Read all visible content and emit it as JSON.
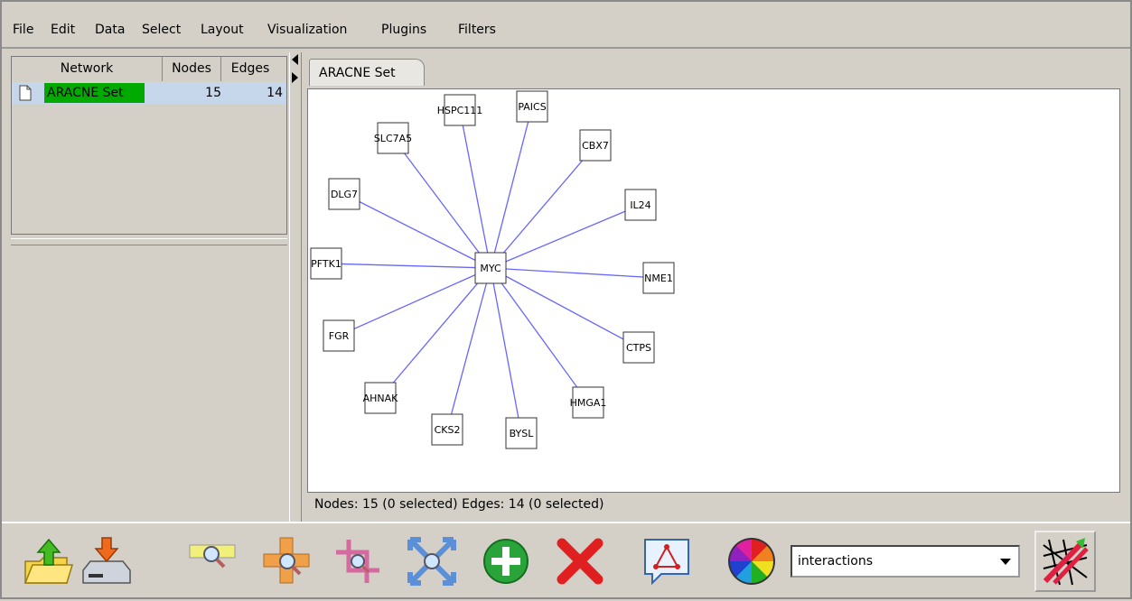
{
  "menubar": [
    "File",
    "Edit",
    "Data",
    "Select",
    "Layout",
    "Visualization",
    "Plugins",
    "Filters"
  ],
  "network_panel": {
    "columns": {
      "network": "Network",
      "nodes": "Nodes",
      "edges": "Edges"
    },
    "rows": [
      {
        "name": "ARACNE Set",
        "nodes": "15",
        "edges": "14"
      }
    ]
  },
  "view": {
    "tab_label": "ARACNE Set",
    "status": "Nodes: 15 (0 selected) Edges: 14 (0 selected)"
  },
  "graph": {
    "edge_color": "#6666ff",
    "center": "MYC",
    "nodes": [
      "MYC",
      "HSPC111",
      "PAICS",
      "SLC7A5",
      "CBX7",
      "DLG7",
      "IL24",
      "PFTK1",
      "NME1",
      "FGR",
      "CTPS",
      "AHNAK",
      "HMGA1",
      "CKS2",
      "BYSL"
    ],
    "edges": [
      [
        "MYC",
        "HSPC111"
      ],
      [
        "MYC",
        "PAICS"
      ],
      [
        "MYC",
        "SLC7A5"
      ],
      [
        "MYC",
        "CBX7"
      ],
      [
        "MYC",
        "DLG7"
      ],
      [
        "MYC",
        "IL24"
      ],
      [
        "MYC",
        "PFTK1"
      ],
      [
        "MYC",
        "NME1"
      ],
      [
        "MYC",
        "FGR"
      ],
      [
        "MYC",
        "CTPS"
      ],
      [
        "MYC",
        "AHNAK"
      ],
      [
        "MYC",
        "HMGA1"
      ],
      [
        "MYC",
        "CKS2"
      ],
      [
        "MYC",
        "BYSL"
      ]
    ]
  },
  "toolbar": {
    "buttons": [
      "open-network-icon",
      "save-network-icon",
      "zoom-in-icon",
      "zoom-out-icon",
      "zoom-selected-icon",
      "zoom-fit-icon",
      "add-icon",
      "delete-icon",
      "create-view-icon",
      "vizmapper-icon"
    ],
    "attribute_select": "interactions",
    "filter_button_icon": "filter-icon"
  },
  "colors": {
    "selected_network": "#00aa00",
    "row_highlight": "#c6d7ec"
  }
}
